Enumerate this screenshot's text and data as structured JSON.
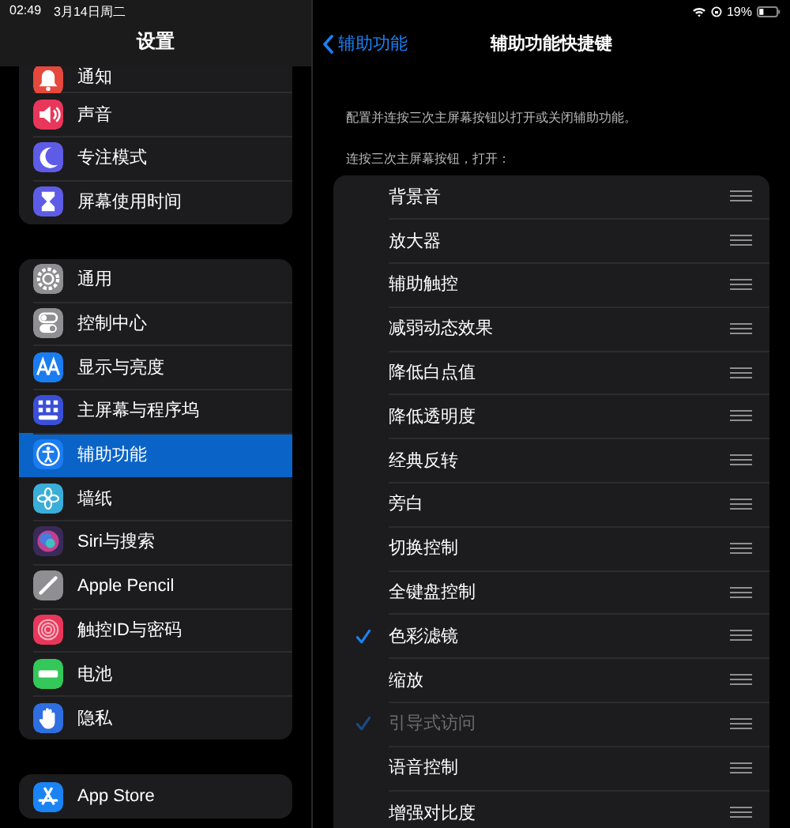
{
  "status_bar": {
    "time": "02:49",
    "date": "3月14日周二",
    "battery": "19%"
  },
  "sidebar": {
    "title": "设置",
    "groups": [
      {
        "items": [
          {
            "label": "通知",
            "color": "#e5483c",
            "selected": false
          },
          {
            "label": "声音",
            "color": "#e8375a",
            "selected": false
          },
          {
            "label": "专注模式",
            "color": "#5e5ce6",
            "selected": false
          },
          {
            "label": "屏幕使用时间",
            "color": "#5e5ce6",
            "selected": false
          }
        ]
      },
      {
        "items": [
          {
            "label": "通用",
            "color": "#8e8e93",
            "selected": false
          },
          {
            "label": "控制中心",
            "color": "#8e8e93",
            "selected": false
          },
          {
            "label": "显示与亮度",
            "color": "#1a7cf0",
            "selected": false
          },
          {
            "label": "主屏幕与程序坞",
            "color": "#3a4fd8",
            "selected": false
          },
          {
            "label": "辅助功能",
            "color": "#1a7cf0",
            "selected": true
          },
          {
            "label": "墙纸",
            "color": "#3aaed8",
            "selected": false
          },
          {
            "label": "Siri与搜索",
            "color": "#3a2a5a",
            "selected": false
          },
          {
            "label": "Apple Pencil",
            "color": "#8e8e93",
            "selected": false
          },
          {
            "label": "触控ID与密码",
            "color": "#e8375a",
            "selected": false
          },
          {
            "label": "电池",
            "color": "#34c759",
            "selected": false
          },
          {
            "label": "隐私",
            "color": "#2f6ee0",
            "selected": false
          }
        ]
      },
      {
        "items": [
          {
            "label": "App Store",
            "color": "#1a84f5",
            "selected": false
          }
        ]
      }
    ]
  },
  "detail": {
    "back": "辅助功能",
    "title": "辅助功能快捷键",
    "description": "配置并连按三次主屏幕按钮以打开或关闭辅助功能。",
    "list_header": "连按三次主屏幕按钮，打开：",
    "items": [
      {
        "label": "背景音",
        "checked": false,
        "disabled": false
      },
      {
        "label": "放大器",
        "checked": false,
        "disabled": false
      },
      {
        "label": "辅助触控",
        "checked": false,
        "disabled": false
      },
      {
        "label": "减弱动态效果",
        "checked": false,
        "disabled": false
      },
      {
        "label": "降低白点值",
        "checked": false,
        "disabled": false
      },
      {
        "label": "降低透明度",
        "checked": false,
        "disabled": false
      },
      {
        "label": "经典反转",
        "checked": false,
        "disabled": false
      },
      {
        "label": "旁白",
        "checked": false,
        "disabled": false
      },
      {
        "label": "切换控制",
        "checked": false,
        "disabled": false
      },
      {
        "label": "全键盘控制",
        "checked": false,
        "disabled": false
      },
      {
        "label": "色彩滤镜",
        "checked": true,
        "disabled": false
      },
      {
        "label": "缩放",
        "checked": false,
        "disabled": false
      },
      {
        "label": "引导式访问",
        "checked": true,
        "disabled": true
      },
      {
        "label": "语音控制",
        "checked": false,
        "disabled": false
      },
      {
        "label": "增强对比度",
        "checked": false,
        "disabled": false
      }
    ]
  }
}
